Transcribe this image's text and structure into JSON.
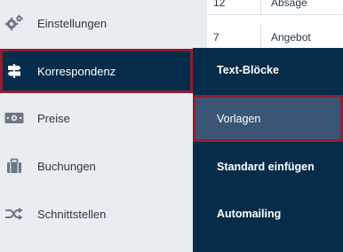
{
  "sidebar": {
    "items": [
      {
        "label": "Einstellungen",
        "icon": "gears-icon",
        "active": false
      },
      {
        "label": "Korrespondenz",
        "icon": "signpost-icon",
        "active": true
      },
      {
        "label": "Preise",
        "icon": "money-icon",
        "active": false
      },
      {
        "label": "Buchungen",
        "icon": "suitcase-icon",
        "active": false
      },
      {
        "label": "Schnittstellen",
        "icon": "shuffle-icon",
        "active": false
      }
    ]
  },
  "table": {
    "rows": [
      {
        "id": "12",
        "type": "Absage"
      },
      {
        "id": "7",
        "type": "Angebot"
      }
    ]
  },
  "submenu": {
    "items": [
      {
        "label": "Text-Blöcke",
        "active": false
      },
      {
        "label": "Vorlagen",
        "active": true
      },
      {
        "label": "Standard einfügen",
        "active": false
      },
      {
        "label": "Automailing",
        "active": false
      }
    ]
  },
  "colors": {
    "sidebar_bg": "#e9ecf1",
    "navy": "#052c4a",
    "highlight_border": "#8e1f33",
    "submenu_active_bg": "#3a5575",
    "icon_gray": "#6b7787",
    "text_dark": "#2a3848"
  }
}
